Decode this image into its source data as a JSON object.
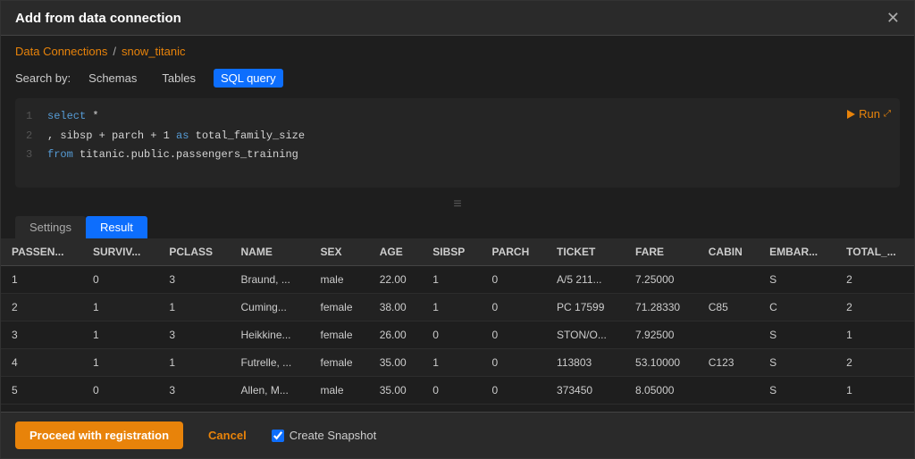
{
  "modal": {
    "title": "Add from data connection",
    "close_label": "✕"
  },
  "breadcrumb": {
    "link_label": "Data Connections",
    "separator": "/",
    "current": "snow_titanic"
  },
  "search": {
    "label": "Search by:",
    "tabs": [
      {
        "label": "Schemas",
        "active": false
      },
      {
        "label": "Tables",
        "active": false
      },
      {
        "label": "SQL query",
        "active": true
      }
    ]
  },
  "code_editor": {
    "lines": [
      {
        "num": "1",
        "text": "select *"
      },
      {
        "num": "2",
        "text": ", sibsp + parch + 1 as total_family_size"
      },
      {
        "num": "3",
        "text": "from titanic.public.passengers_training"
      }
    ],
    "run_label": "Run"
  },
  "drag_handle": "≡",
  "tabs": [
    {
      "label": "Settings",
      "active": false
    },
    {
      "label": "Result",
      "active": true
    }
  ],
  "table": {
    "columns": [
      "PASSEN...",
      "SURVIV...",
      "PCLASS",
      "NAME",
      "SEX",
      "AGE",
      "SIBSP",
      "PARCH",
      "TICKET",
      "FARE",
      "CABIN",
      "EMBAR...",
      "TOTAL_..."
    ],
    "rows": [
      [
        "1",
        "0",
        "3",
        "Braund, ...",
        "male",
        "22.00",
        "1",
        "0",
        "A/5 211...",
        "7.25000",
        "",
        "S",
        "2"
      ],
      [
        "2",
        "1",
        "1",
        "Cuming...",
        "female",
        "38.00",
        "1",
        "0",
        "PC 17599",
        "71.28330",
        "C85",
        "C",
        "2"
      ],
      [
        "3",
        "1",
        "3",
        "Heikkine...",
        "female",
        "26.00",
        "0",
        "0",
        "STON/O...",
        "7.92500",
        "",
        "S",
        "1"
      ],
      [
        "4",
        "1",
        "1",
        "Futrelle, ...",
        "female",
        "35.00",
        "1",
        "0",
        "113803",
        "53.10000",
        "C123",
        "S",
        "2"
      ],
      [
        "5",
        "0",
        "3",
        "Allen, M...",
        "male",
        "35.00",
        "0",
        "0",
        "373450",
        "8.05000",
        "",
        "S",
        "1"
      ]
    ]
  },
  "footer": {
    "proceed_label": "Proceed with registration",
    "cancel_label": "Cancel",
    "snapshot_label": "Create Snapshot",
    "snapshot_checked": true
  }
}
